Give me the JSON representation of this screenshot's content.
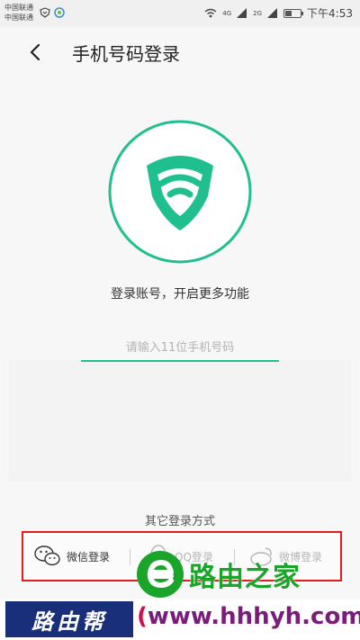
{
  "statusbar": {
    "carrier1": "中国联通",
    "carrier2": "中国联通",
    "net1": "4G",
    "net2": "2G",
    "time": "下午4:53"
  },
  "header": {
    "title": "手机号码登录"
  },
  "main": {
    "subtitle": "登录账号，开启更多功能",
    "phone_placeholder": "请输入11位手机号码"
  },
  "other_login": {
    "label": "其它登录方式",
    "wechat": "微信登录",
    "qq": "QQ登录",
    "weibo": "微博登录"
  },
  "watermark": {
    "logo_text": "路由之家",
    "badge_text": "路由帮",
    "url_open": "(",
    "url": "www.hhhyh.com",
    "url_close": ")"
  },
  "colors": {
    "accent": "#1fbf8f",
    "highlight": "#e21c1c"
  }
}
